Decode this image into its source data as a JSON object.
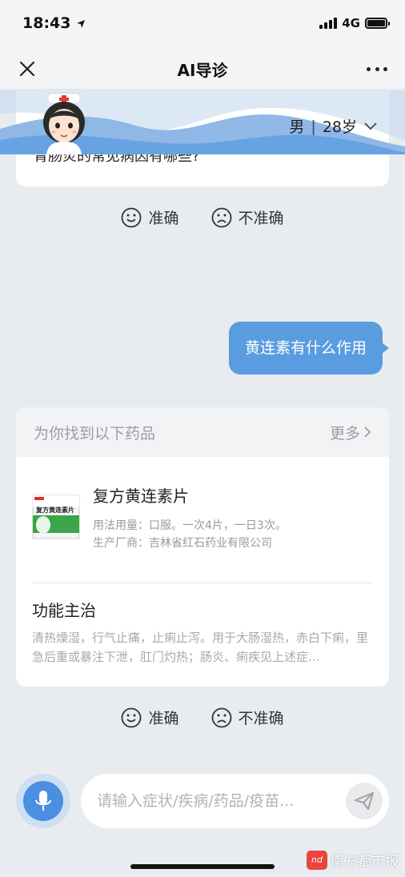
{
  "status_bar": {
    "time": "18:43",
    "network": "4G",
    "battery_level": 1.0
  },
  "nav": {
    "title": "AI导诊"
  },
  "profile": {
    "gender": "男",
    "age": "28岁"
  },
  "previous_card": {
    "text": "胃肠炎的常见病因有哪些?"
  },
  "feedback": {
    "accurate": "准确",
    "inaccurate": "不准确"
  },
  "user_message": "黄连素有什么作用",
  "drug_card": {
    "title": "为你找到以下药品",
    "more": "更多",
    "drug": {
      "name": "复方黄连素片",
      "package_label": "复方黄连素片",
      "usage": "用法用量：口服。一次4片，一日3次。",
      "manufacturer": "生产厂商：吉林省红石药业有限公司"
    },
    "function_title": "功能主治",
    "function_text": "清热燥湿，行气止痛，止痢止泻。用于大肠湿热，赤白下痢，里急后重或暴注下泄，肛门灼热；肠炎、痢疾见上述症..."
  },
  "input": {
    "placeholder": "请输入症状/疾病/药品/疫苗..."
  },
  "watermark": {
    "logo": "nd",
    "text": "南方都市报"
  },
  "colors": {
    "accent": "#5a9ce0",
    "background": "#e8ecf0",
    "mic": "#4a8fe0"
  }
}
